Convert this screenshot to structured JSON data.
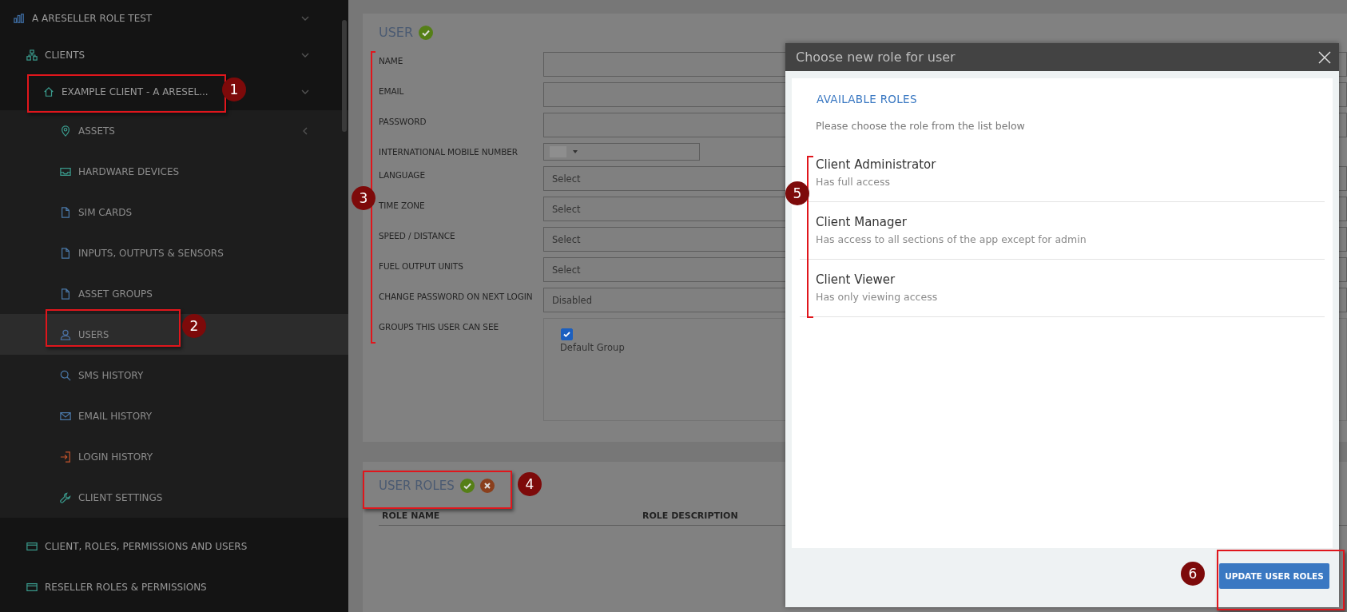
{
  "sidebar": {
    "items": [
      {
        "label": "A ARESELLER ROLE TEST",
        "expanded": true,
        "selected": false,
        "children": [
          {
            "label": "CLIENTS",
            "expanded": true,
            "selected": false,
            "children": [
              {
                "label": "EXAMPLE CLIENT - A ARESEL...",
                "expanded": true,
                "selected": false,
                "children": [
                  {
                    "label": "ASSETS",
                    "expanded": false,
                    "selected": false
                  },
                  {
                    "label": "HARDWARE DEVICES",
                    "selected": false
                  },
                  {
                    "label": "SIM CARDS",
                    "selected": false
                  },
                  {
                    "label": "INPUTS, OUTPUTS & SENSORS",
                    "selected": false
                  },
                  {
                    "label": "ASSET GROUPS",
                    "selected": false
                  },
                  {
                    "label": "USERS",
                    "selected": true
                  },
                  {
                    "label": "SMS HISTORY",
                    "selected": false
                  },
                  {
                    "label": "EMAIL HISTORY",
                    "selected": false
                  },
                  {
                    "label": "LOGIN HISTORY",
                    "selected": false
                  },
                  {
                    "label": "CLIENT SETTINGS",
                    "selected": false
                  }
                ]
              }
            ]
          },
          {
            "label": "CLIENT, ROLES, PERMISSIONS AND USERS",
            "selected": false
          },
          {
            "label": "RESELLER ROLES & PERMISSIONS",
            "selected": false
          }
        ]
      }
    ]
  },
  "user_form": {
    "title": "USER",
    "fields": [
      {
        "label": "NAME",
        "kind": "text"
      },
      {
        "label": "EMAIL",
        "kind": "text"
      },
      {
        "label": "PASSWORD",
        "kind": "text"
      },
      {
        "label": "INTERNATIONAL MOBILE NUMBER",
        "kind": "phone"
      },
      {
        "label": "LANGUAGE",
        "kind": "select",
        "value": "Select"
      },
      {
        "label": "TIME ZONE",
        "kind": "select",
        "value": "Select"
      },
      {
        "label": "SPEED / DISTANCE",
        "kind": "select",
        "value": "Select"
      },
      {
        "label": "FUEL OUTPUT UNITS",
        "kind": "select",
        "value": "Select"
      },
      {
        "label": "CHANGE PASSWORD ON NEXT LOGIN",
        "kind": "select",
        "value": "Disabled"
      },
      {
        "label": "GROUPS THIS USER CAN SEE",
        "kind": "checklist",
        "options": [
          {
            "label": "Default Group",
            "checked": true
          }
        ]
      }
    ]
  },
  "user_roles": {
    "title": "USER ROLES",
    "columns": [
      "ROLE NAME",
      "ROLE DESCRIPTION"
    ]
  },
  "dialog": {
    "title": "Choose new role for user",
    "section_title": "AVAILABLE ROLES",
    "instructions": "Please choose the role from the list below",
    "roles": [
      {
        "name": "Client Administrator",
        "description": "Has full access"
      },
      {
        "name": "Client Manager",
        "description": "Has access to all sections of the app except for admin"
      },
      {
        "name": "Client Viewer",
        "description": "Has only viewing access"
      }
    ],
    "button": "UPDATE USER ROLES"
  },
  "annotations": [
    {
      "number": "1",
      "kind": "box"
    },
    {
      "number": "2",
      "kind": "box"
    },
    {
      "number": "3",
      "kind": "bracket"
    },
    {
      "number": "4",
      "kind": "box"
    },
    {
      "number": "5",
      "kind": "bracket"
    },
    {
      "number": "6",
      "kind": "box"
    }
  ]
}
